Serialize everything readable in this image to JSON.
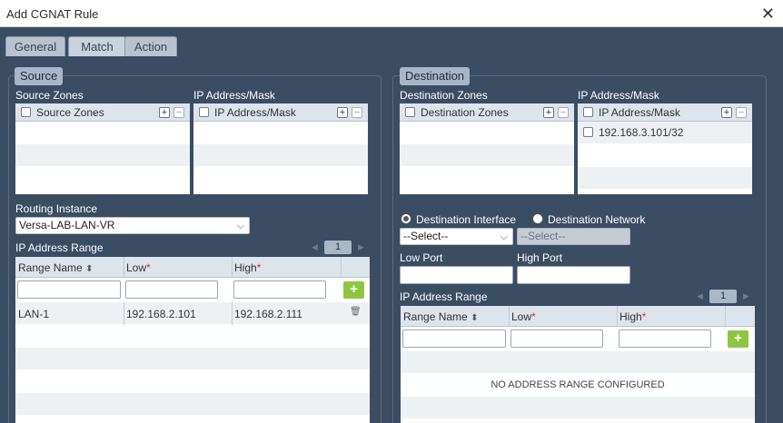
{
  "window": {
    "title": "Add CGNAT Rule"
  },
  "tabs": [
    {
      "label": "General"
    },
    {
      "label": "Match"
    },
    {
      "label": "Action"
    }
  ],
  "source": {
    "legend": "Source",
    "zones_label": "Source Zones",
    "zones_header": "Source Zones",
    "ip_label": "IP Address/Mask",
    "ip_header": "IP Address/Mask",
    "routing_label": "Routing Instance",
    "routing_value": "Versa-LAB-LAN-VR",
    "range_label": "IP Address Range",
    "page_num": "1",
    "cols": {
      "name": "Range Name",
      "low": "Low",
      "high": "High"
    },
    "rows": [
      {
        "name": "LAN-1",
        "low": "192.168.2.101",
        "high": "192.168.2.111"
      }
    ]
  },
  "destination": {
    "legend": "Destination",
    "zones_label": "Destination Zones",
    "zones_header": "Destination Zones",
    "ip_label": "IP Address/Mask",
    "ip_header": "IP Address/Mask",
    "ip_rows": [
      "192.168.3.101/32"
    ],
    "radio_interface": "Destination Interface",
    "radio_network": "Destination Network",
    "select_interface": "--Select--",
    "select_network": "--Select--",
    "low_port_label": "Low Port",
    "high_port_label": "High Port",
    "range_label": "IP Address Range",
    "page_num": "1",
    "cols": {
      "name": "Range Name",
      "low": "Low",
      "high": "High"
    },
    "empty_text": "NO ADDRESS RANGE CONFIGURED"
  },
  "symbols": {
    "required": "*",
    "close": "✕",
    "add": "+",
    "chevron": "⌵",
    "plus_box": "+",
    "minus_box": "−",
    "sort": "⬍",
    "trash": "🗑",
    "prev": "◀",
    "next": "▶"
  }
}
